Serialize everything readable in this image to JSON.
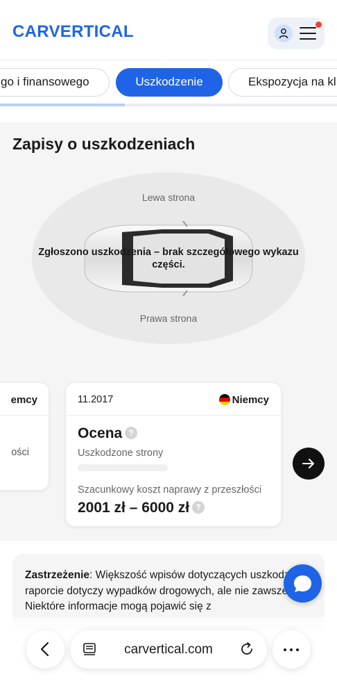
{
  "header": {
    "logo_text": "CARVERTICAL",
    "brand_color": "#1f64e6",
    "account_icon": "user-icon",
    "menu_icon": "hamburger-menu-icon",
    "notification_dot_color": "#e8423a"
  },
  "tabs": {
    "items": [
      {
        "label": "Zastaw i finansowego",
        "visible_label": "go i finansowego",
        "active": false
      },
      {
        "label": "Uszkodzenie",
        "active": true
      },
      {
        "label": "Ekspozycja na kl",
        "visible_label": "Ekspozycja na kl",
        "active": false
      }
    ],
    "progress": 0.37
  },
  "damage_section": {
    "title": "Zapisy o uszkodzeniach",
    "diagram": {
      "left_side_label": "Lewa strona",
      "right_side_label": "Prawa strona",
      "message": "Zgłoszono uszkodzenia – brak szczegółowego wykazu części."
    },
    "prev_card": {
      "country": "emcy",
      "fragment": "ości"
    },
    "card": {
      "date": "11.2017",
      "country": "Niemcy",
      "flag_icon": "germany-flag-icon",
      "title": "Ocena",
      "help_icon": "question-icon",
      "damaged_sides_label": "Uszkodzone strony",
      "cost_label": "Szacunkowy koszt naprawy z przeszłości",
      "cost_value": "2001 zł – 6000 zł"
    },
    "next_icon": "arrow-right-icon"
  },
  "disclaimer": {
    "bold": "Zastrzeżenie",
    "text": ": Większość wpisów dotyczących uszkodzeń w raporcie dotyczy wypadków drogowych, ale nie zawsze. Niektóre informacje mogą pojawić się z"
  },
  "chat": {
    "icon": "chat-bubble-icon"
  },
  "browser": {
    "back_icon": "chevron-left-icon",
    "reader_icon": "reader-mode-icon",
    "url": "carvertical.com",
    "reload_icon": "reload-icon",
    "more_icon": "more-dots-icon"
  }
}
